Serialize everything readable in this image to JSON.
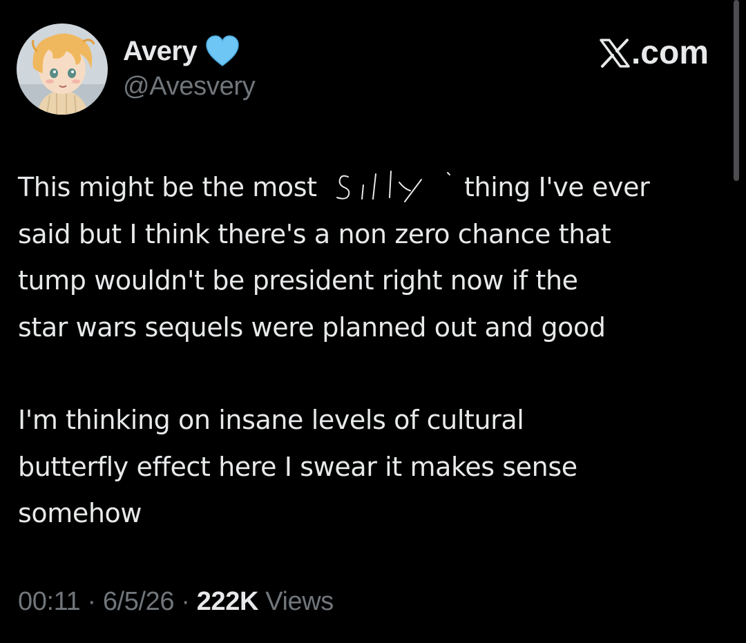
{
  "author": {
    "display_name": "Avery",
    "handle": "@Avesvery",
    "badge_icon": "blue-heart-icon",
    "badge_color": "#6ec6f5"
  },
  "brand": {
    "icon": "x-logo-icon",
    "label": ".com"
  },
  "tweet": {
    "line1_pre": "This might be the most",
    "scribble_word": "silly",
    "line1_post": "thing I've ever",
    "line2_pre": "said but I think there's a",
    "line2_partial": "non",
    "line2_post": "zero chance that",
    "line3": "tump wouldn't be president right now if the",
    "line4": "star wars sequels were planned out and good",
    "line5": "I'm thinking on insane levels of cultural",
    "line6": "butterfly effect here I swear it makes sense",
    "line7": "somehow"
  },
  "meta": {
    "time": "00:11",
    "separator": "·",
    "date": "6/5/26",
    "views_count": "222K",
    "views_label": "Views"
  },
  "colors": {
    "background": "#000000",
    "primary_text": "#e7e9ea",
    "secondary_text": "#71767b"
  }
}
